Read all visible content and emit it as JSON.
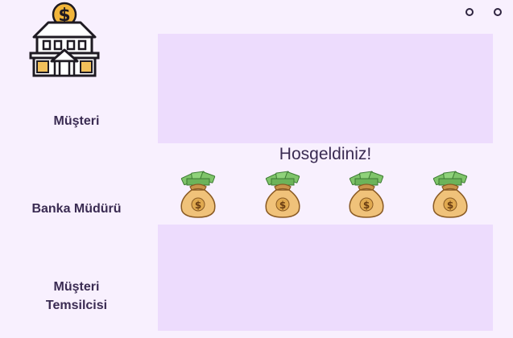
{
  "window": {
    "controls": [
      "window-button",
      "window-button"
    ]
  },
  "sidebar": {
    "logo_icon": "bank-dollar-icon",
    "roles": [
      {
        "label": "Müşteri"
      },
      {
        "label": "Banka Müdürü"
      },
      {
        "label": "Müşteri\nTemsilcisi"
      }
    ]
  },
  "main": {
    "welcome_text": "Hosgeldiniz!",
    "decor_icon": "money-bag-icon",
    "bag_count": 4
  },
  "colors": {
    "background": "#f8f0fe",
    "panel": "#eddcfd",
    "text": "#3a2b52",
    "gold": "#f2c05a"
  }
}
